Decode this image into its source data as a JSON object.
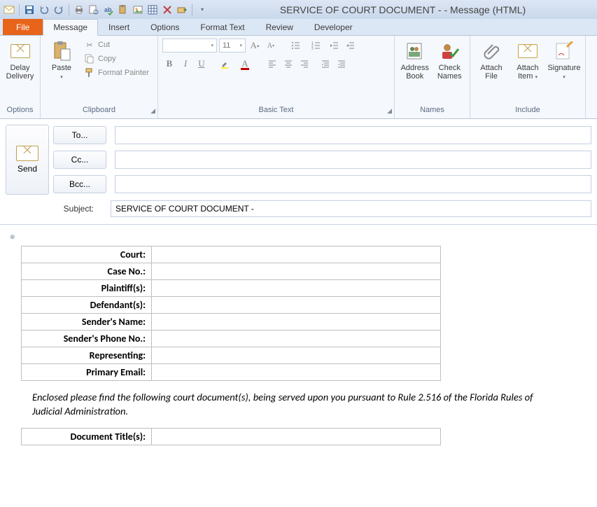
{
  "window": {
    "title": "SERVICE OF COURT DOCUMENT -  - Message (HTML)"
  },
  "tabs": {
    "file": "File",
    "message": "Message",
    "insert": "Insert",
    "options": "Options",
    "format_text": "Format Text",
    "review": "Review",
    "developer": "Developer"
  },
  "ribbon": {
    "options_group": "Options",
    "delay_delivery": "Delay Delivery",
    "clipboard_group": "Clipboard",
    "paste": "Paste",
    "cut": "Cut",
    "copy": "Copy",
    "format_painter": "Format Painter",
    "basic_text_group": "Basic Text",
    "font_size": "11",
    "names_group": "Names",
    "address_book": "Address Book",
    "check_names": "Check Names",
    "include_group": "Include",
    "attach_file": "Attach File",
    "attach_item": "Attach Item",
    "signature": "Signature"
  },
  "header": {
    "send": "Send",
    "to": "To...",
    "cc": "Cc...",
    "bcc": "Bcc...",
    "subject_label": "Subject:",
    "subject_value": "SERVICE OF COURT DOCUMENT - "
  },
  "body": {
    "fields": [
      "Court:",
      "Case No.:",
      "Plaintiff(s):",
      "Defendant(s):",
      "Sender's Name:",
      "Sender's Phone No.:",
      "Representing:",
      "Primary Email:"
    ],
    "paragraph": "Enclosed please find  the following court document(s), being served upon you pursuant to Rule 2.516 of the Florida Rules of Judicial Administration.",
    "doc_title_label": "Document Title(s):"
  }
}
